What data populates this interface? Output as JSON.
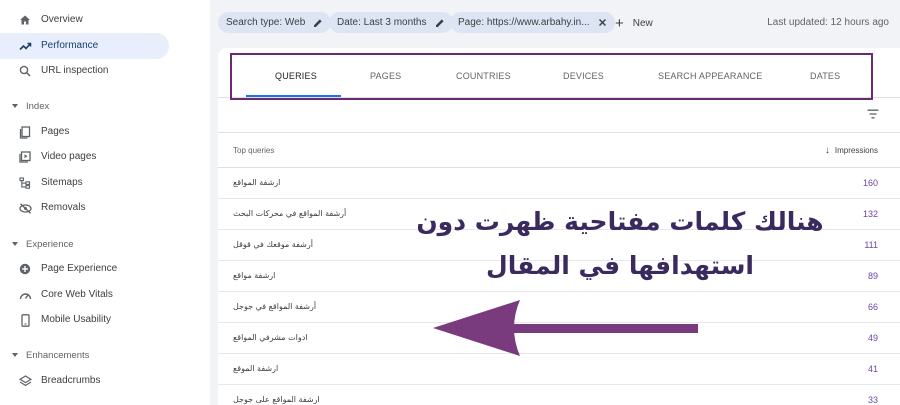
{
  "sidebar": {
    "items": [
      {
        "label": "Overview",
        "icon": "home-icon"
      },
      {
        "label": "Performance",
        "icon": "trending-up-icon",
        "active": true
      },
      {
        "label": "URL inspection",
        "icon": "search-icon"
      }
    ],
    "sections": [
      {
        "title": "Index",
        "items": [
          {
            "label": "Pages",
            "icon": "pages-icon"
          },
          {
            "label": "Video pages",
            "icon": "video-pages-icon"
          },
          {
            "label": "Sitemaps",
            "icon": "sitemaps-icon"
          },
          {
            "label": "Removals",
            "icon": "removals-icon"
          }
        ]
      },
      {
        "title": "Experience",
        "items": [
          {
            "label": "Page Experience",
            "icon": "page-experience-icon"
          },
          {
            "label": "Core Web Vitals",
            "icon": "gauge-icon"
          },
          {
            "label": "Mobile Usability",
            "icon": "mobile-icon"
          }
        ]
      },
      {
        "title": "Enhancements",
        "items": [
          {
            "label": "Breadcrumbs",
            "icon": "layers-icon"
          }
        ]
      }
    ]
  },
  "filters": {
    "chips": [
      {
        "label": "Search type: Web",
        "action_icon": "edit-icon"
      },
      {
        "label": "Date: Last 3 months",
        "action_icon": "edit-icon"
      },
      {
        "label": "Page: https://www.arbahy.in...",
        "action_icon": "close-icon"
      }
    ],
    "new_label": "New",
    "last_updated": "Last updated: 12 hours ago"
  },
  "tabs": [
    "QUERIES",
    "PAGES",
    "COUNTRIES",
    "DEVICES",
    "SEARCH APPEARANCE",
    "DATES"
  ],
  "active_tab": "QUERIES",
  "table": {
    "col_query": "Top queries",
    "col_metric": "Impressions",
    "rows": [
      {
        "query": "ارشفة المواقع",
        "impressions": "160"
      },
      {
        "query": "أرشفة المواقع في محركات البحث",
        "impressions": "132"
      },
      {
        "query": "أرشفة موقعك في قوقل",
        "impressions": "111"
      },
      {
        "query": "ارشفة مواقع",
        "impressions": "89"
      },
      {
        "query": "أرشفة المواقع في جوجل",
        "impressions": "66"
      },
      {
        "query": "ادوات مشرفي المواقع",
        "impressions": "49"
      },
      {
        "query": "ارشفة الموقع",
        "impressions": "41"
      },
      {
        "query": "ارشفة المواقع على جوجل",
        "impressions": "33"
      }
    ]
  },
  "annotation": {
    "line1": "هنالك كلمات مفتاحية ظهرت دون",
    "line2": "استهدافها في المقال",
    "color": "#7a3a7e"
  },
  "colors": {
    "accent": "#1a73e8",
    "metric": "#6b45a8",
    "highlight": "#6b2a74",
    "active_nav_bg": "#e8eefb"
  }
}
